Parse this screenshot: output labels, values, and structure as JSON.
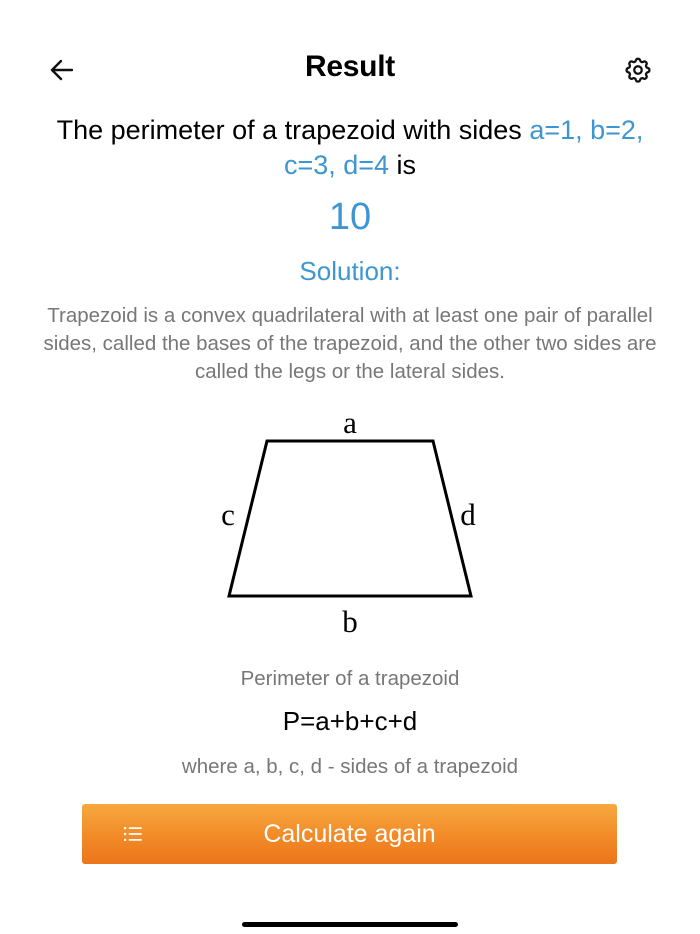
{
  "header": {
    "title": "Result",
    "back_icon": "arrow-left-icon",
    "settings_icon": "gear-icon"
  },
  "result": {
    "prefix": "The perimeter of a trapezoid with sides ",
    "sides": "a=1, b=2, c=3, d=4",
    "suffix": " is",
    "value": "10"
  },
  "solution": {
    "heading": "Solution:",
    "description": "Trapezoid is a convex quadrilateral with at least one pair of parallel sides, called the bases of the trapezoid, and the other two sides are called the legs or the lateral sides."
  },
  "diagram": {
    "labels": {
      "top": "a",
      "bottom": "b",
      "left": "c",
      "right": "d"
    }
  },
  "formula": {
    "caption": "Perimeter of a trapezoid",
    "expression": "P=a+b+c+d",
    "note": "where a, b, c, d - sides of a trapezoid"
  },
  "action": {
    "label": "Calculate again",
    "icon": "list-icon"
  },
  "colors": {
    "accent": "#3d96d2",
    "button_top": "#f7a83f",
    "button_bottom": "#ec751b",
    "secondary_text": "#777777"
  }
}
